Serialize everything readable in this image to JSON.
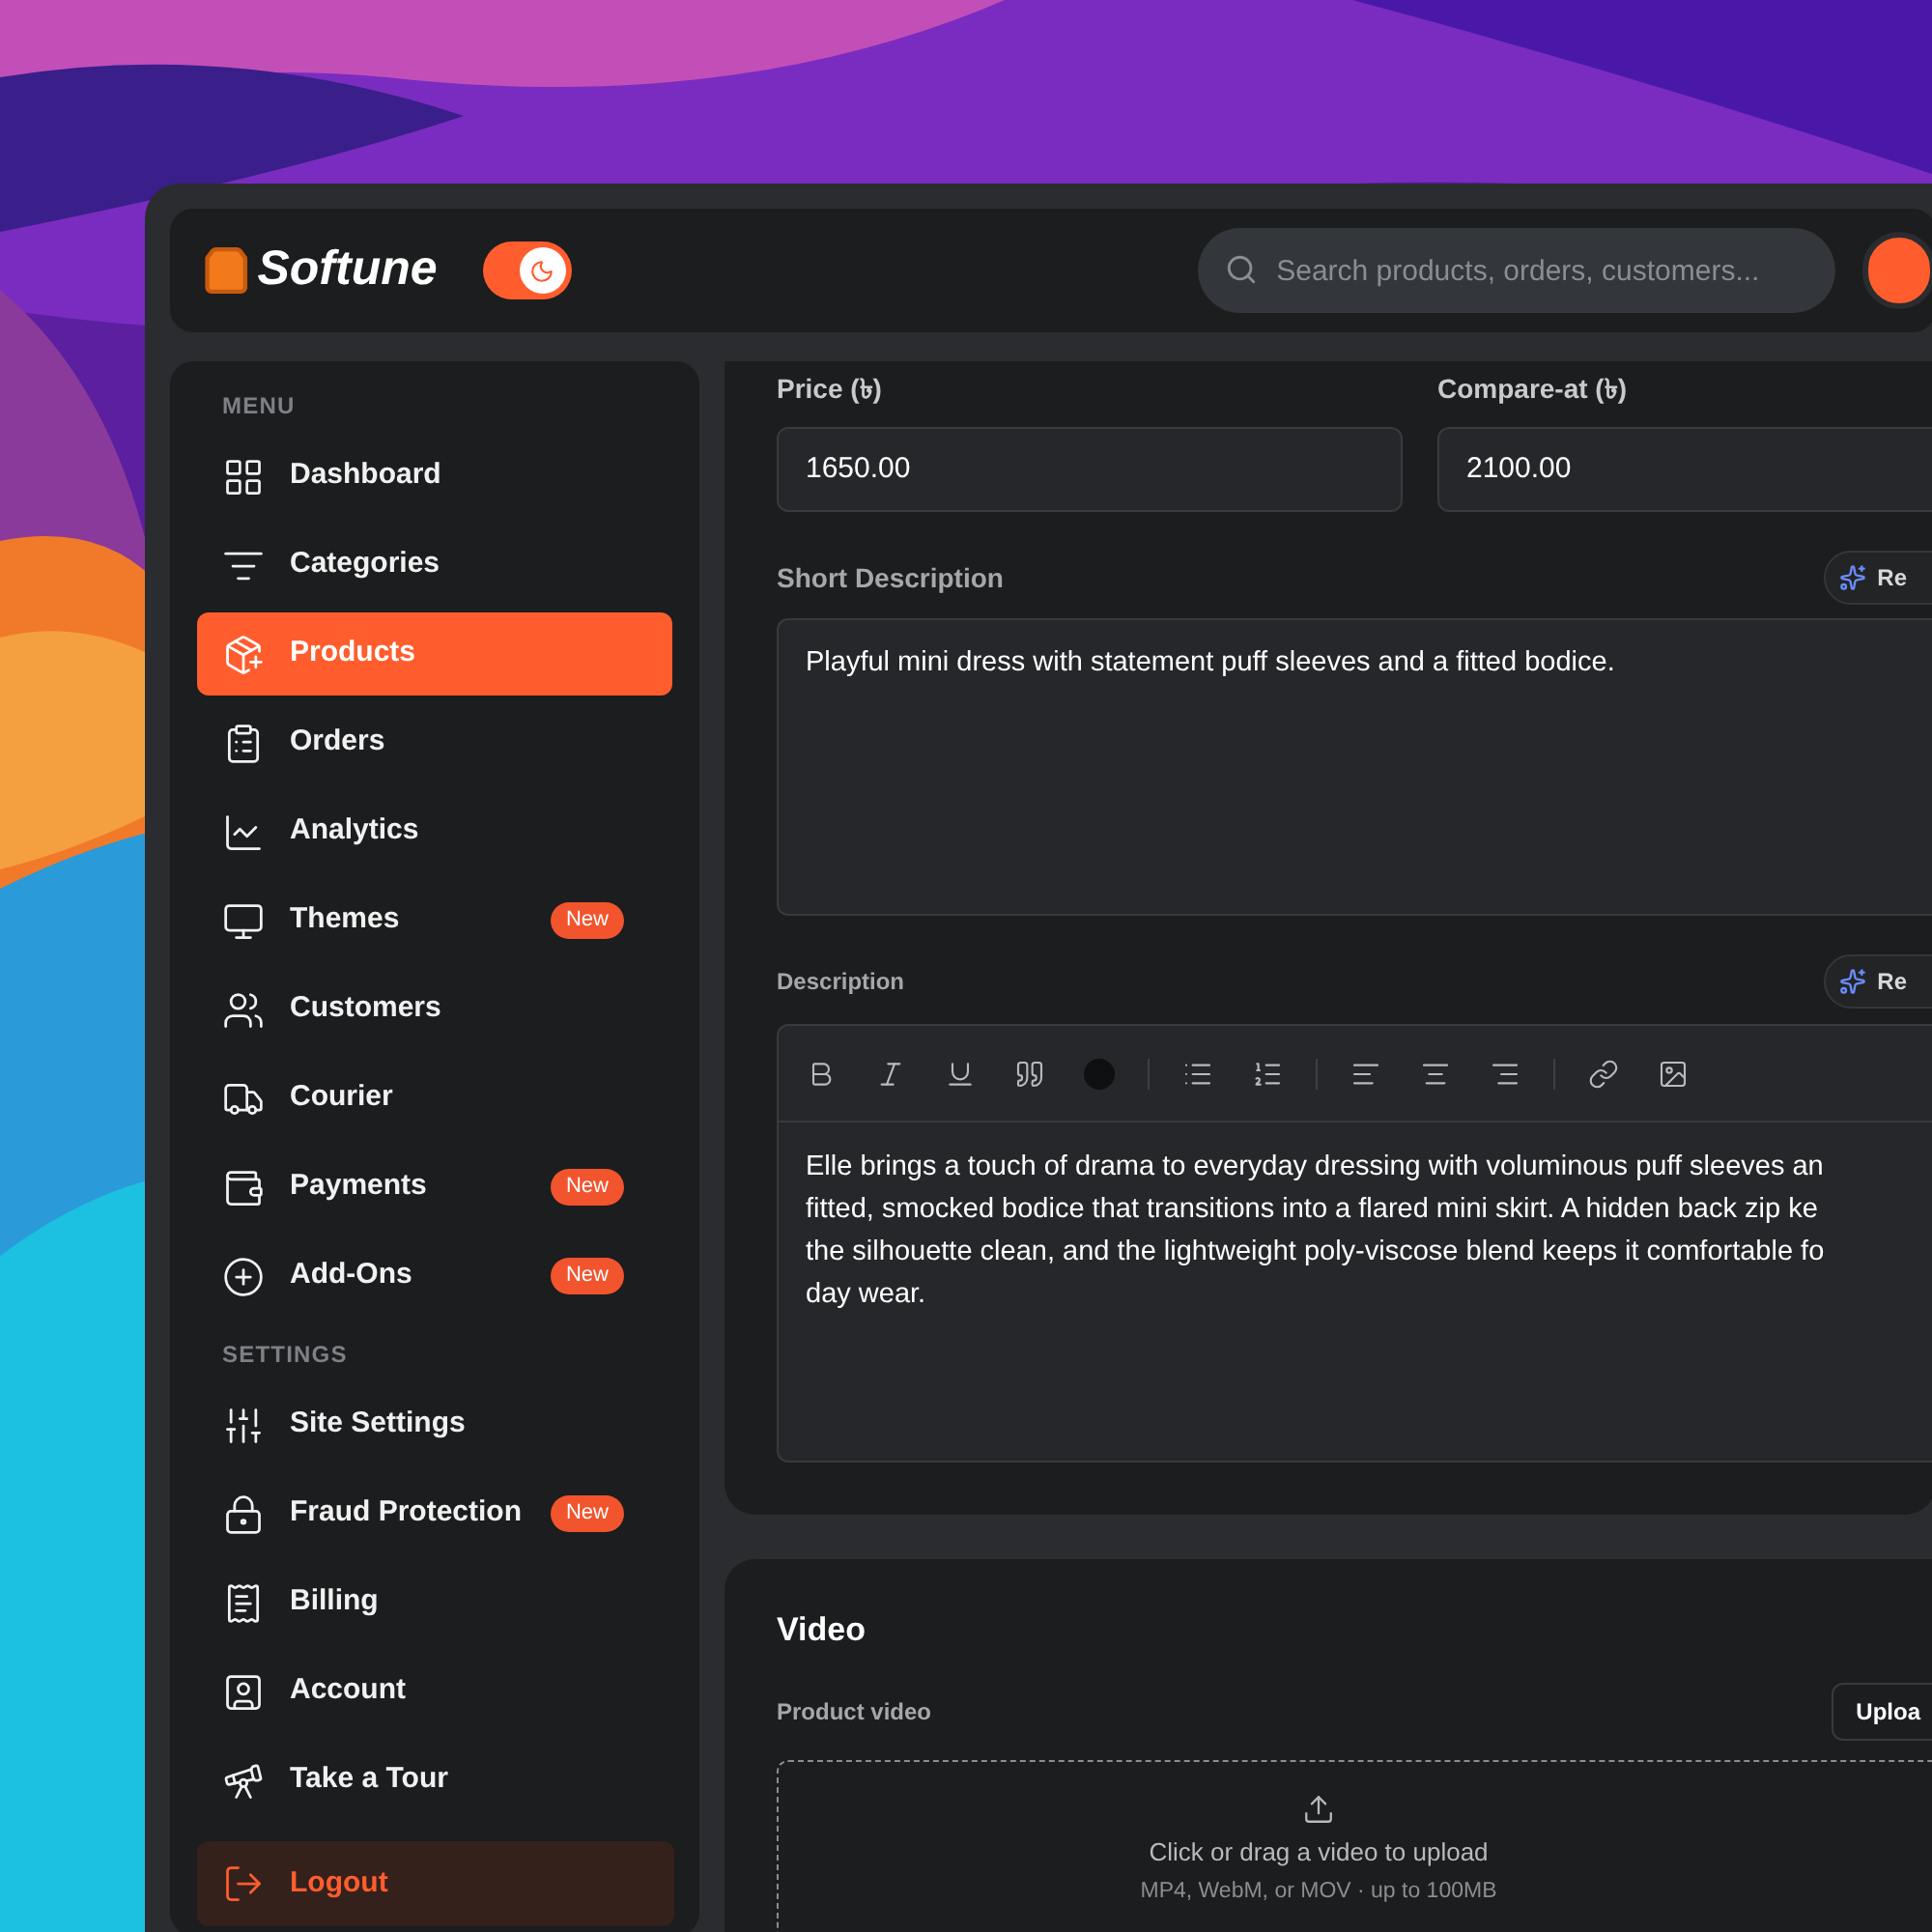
{
  "header": {
    "logo": "Softune",
    "theme_toggle": {
      "on": true
    },
    "search": {
      "placeholder": "Search products, orders, customers..."
    }
  },
  "sidebar": {
    "sections": [
      {
        "title": "MENU",
        "items": [
          {
            "label": "Dashboard",
            "selected": false
          },
          {
            "label": "Categories",
            "selected": false
          },
          {
            "label": "Products",
            "selected": true
          },
          {
            "label": "Orders",
            "selected": false
          },
          {
            "label": "Analytics",
            "selected": false
          },
          {
            "label": "Themes",
            "selected": false,
            "badge": "New"
          },
          {
            "label": "Customers",
            "selected": false
          },
          {
            "label": "Courier",
            "selected": false
          },
          {
            "label": "Payments",
            "selected": false,
            "badge": "New"
          },
          {
            "label": "Add-Ons",
            "selected": false,
            "badge": "New"
          }
        ]
      },
      {
        "title": "SETTINGS",
        "items": [
          {
            "label": "Site Settings",
            "selected": false
          },
          {
            "label": "Fraud Protection",
            "selected": false,
            "badge": "New"
          },
          {
            "label": "Billing",
            "selected": false
          },
          {
            "label": "Account",
            "selected": false
          },
          {
            "label": "Take a Tour",
            "selected": false
          }
        ]
      }
    ],
    "logout": "Logout"
  },
  "form": {
    "price": {
      "label": "Price (৳)",
      "value": "1650.00"
    },
    "compare_at": {
      "label": "Compare-at (৳)",
      "value": "2100.00"
    },
    "short_description": {
      "label": "Short Description",
      "ai_button": "Re",
      "value": "Playful mini dress with statement puff sleeves and a fitted bodice."
    },
    "description": {
      "label": "Description",
      "ai_button": "Re",
      "value": "Elle brings a touch of drama to everyday dressing with voluminous puff sleeves an\nfitted, smocked bodice that transitions into a flared mini skirt. A hidden back zip ke\nthe silhouette clean, and the lightweight poly-viscose blend keeps it comfortable fo\nday wear."
    }
  },
  "video": {
    "title": "Video",
    "label": "Product video",
    "upload_button": "Uploa",
    "dropzone": {
      "text": "Click or drag a video to upload",
      "hint": "MP4, WebM, or MOV · up to 100MB"
    }
  }
}
